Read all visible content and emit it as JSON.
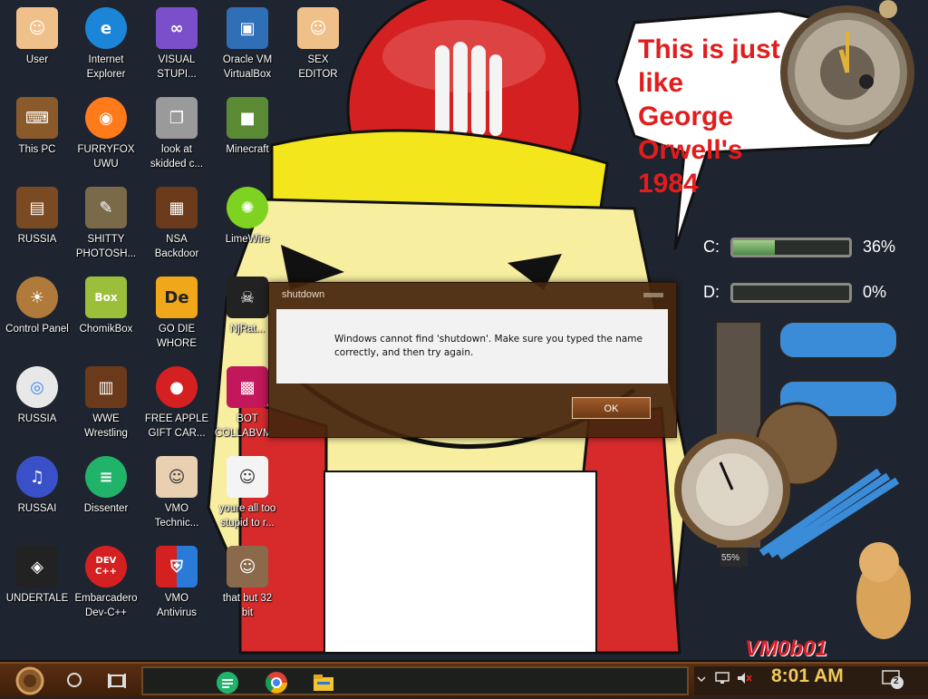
{
  "desktop": {
    "icons": [
      {
        "label": "User"
      },
      {
        "label": "Internet\nExplorer"
      },
      {
        "label": "VISUAL\nSTUPI..."
      },
      {
        "label": "Oracle VM\nVirtualBox"
      },
      {
        "label": "SEX\nEDITOR"
      },
      {
        "label": "This PC"
      },
      {
        "label": "FURRYFOX\nUWU"
      },
      {
        "label": "look at\nskidded c..."
      },
      {
        "label": "Minecraft"
      },
      {
        "label": "RUSSIA"
      },
      {
        "label": "SHITTY\nPHOTOSH..."
      },
      {
        "label": "NSA\nBackdoor"
      },
      {
        "label": "LimeWire"
      },
      {
        "label": "Control Panel"
      },
      {
        "label": "ChomikBox"
      },
      {
        "label": "GO DIE\nWHORE"
      },
      {
        "label": "NjRat..."
      },
      {
        "label": "RUSSIA"
      },
      {
        "label": "WWE\nWrestling"
      },
      {
        "label": "FREE APPLE\nGIFT CAR..."
      },
      {
        "label": "BOT\nCOLLABVM..."
      },
      {
        "label": "RUSSAI"
      },
      {
        "label": "Dissenter"
      },
      {
        "label": "VMO\nTechnic..."
      },
      {
        "label": "youre all too\nstupid to r..."
      },
      {
        "label": "UNDERTALE"
      },
      {
        "label": "Embarcadero\nDev-C++"
      },
      {
        "label": "VMO\nAntivirus"
      },
      {
        "label": "that but 32\nbit"
      }
    ],
    "icon_badges": {
      "chomikbox": "Box",
      "godie": "De",
      "dev": "DEV\nC++"
    }
  },
  "wallpaper": {
    "bubble_text": "This is just like\nGeorge Orwell's\n1984"
  },
  "drives": [
    {
      "letter": "C:",
      "percent_text": "36%",
      "fill": 0.36
    },
    {
      "letter": "D:",
      "percent_text": "0%",
      "fill": 0.0
    }
  ],
  "gauge_readout": "55%",
  "dialog": {
    "title": "shutdown",
    "message": "Windows cannot find 'shutdown'. Make sure you typed the name correctly, and then try again.",
    "ok_label": "OK"
  },
  "signature": "VM0b01",
  "taskbar": {
    "time": "8:01 AM",
    "notification_count": "2",
    "pinned": [
      "dissenter-icon",
      "chrome-icon",
      "file-explorer-icon"
    ]
  },
  "colors": {
    "bubble_text": "#e11d1d",
    "dialog_frame": "#46260e",
    "taskbar": "#4a250e",
    "clock_text": "#f2c85a"
  }
}
